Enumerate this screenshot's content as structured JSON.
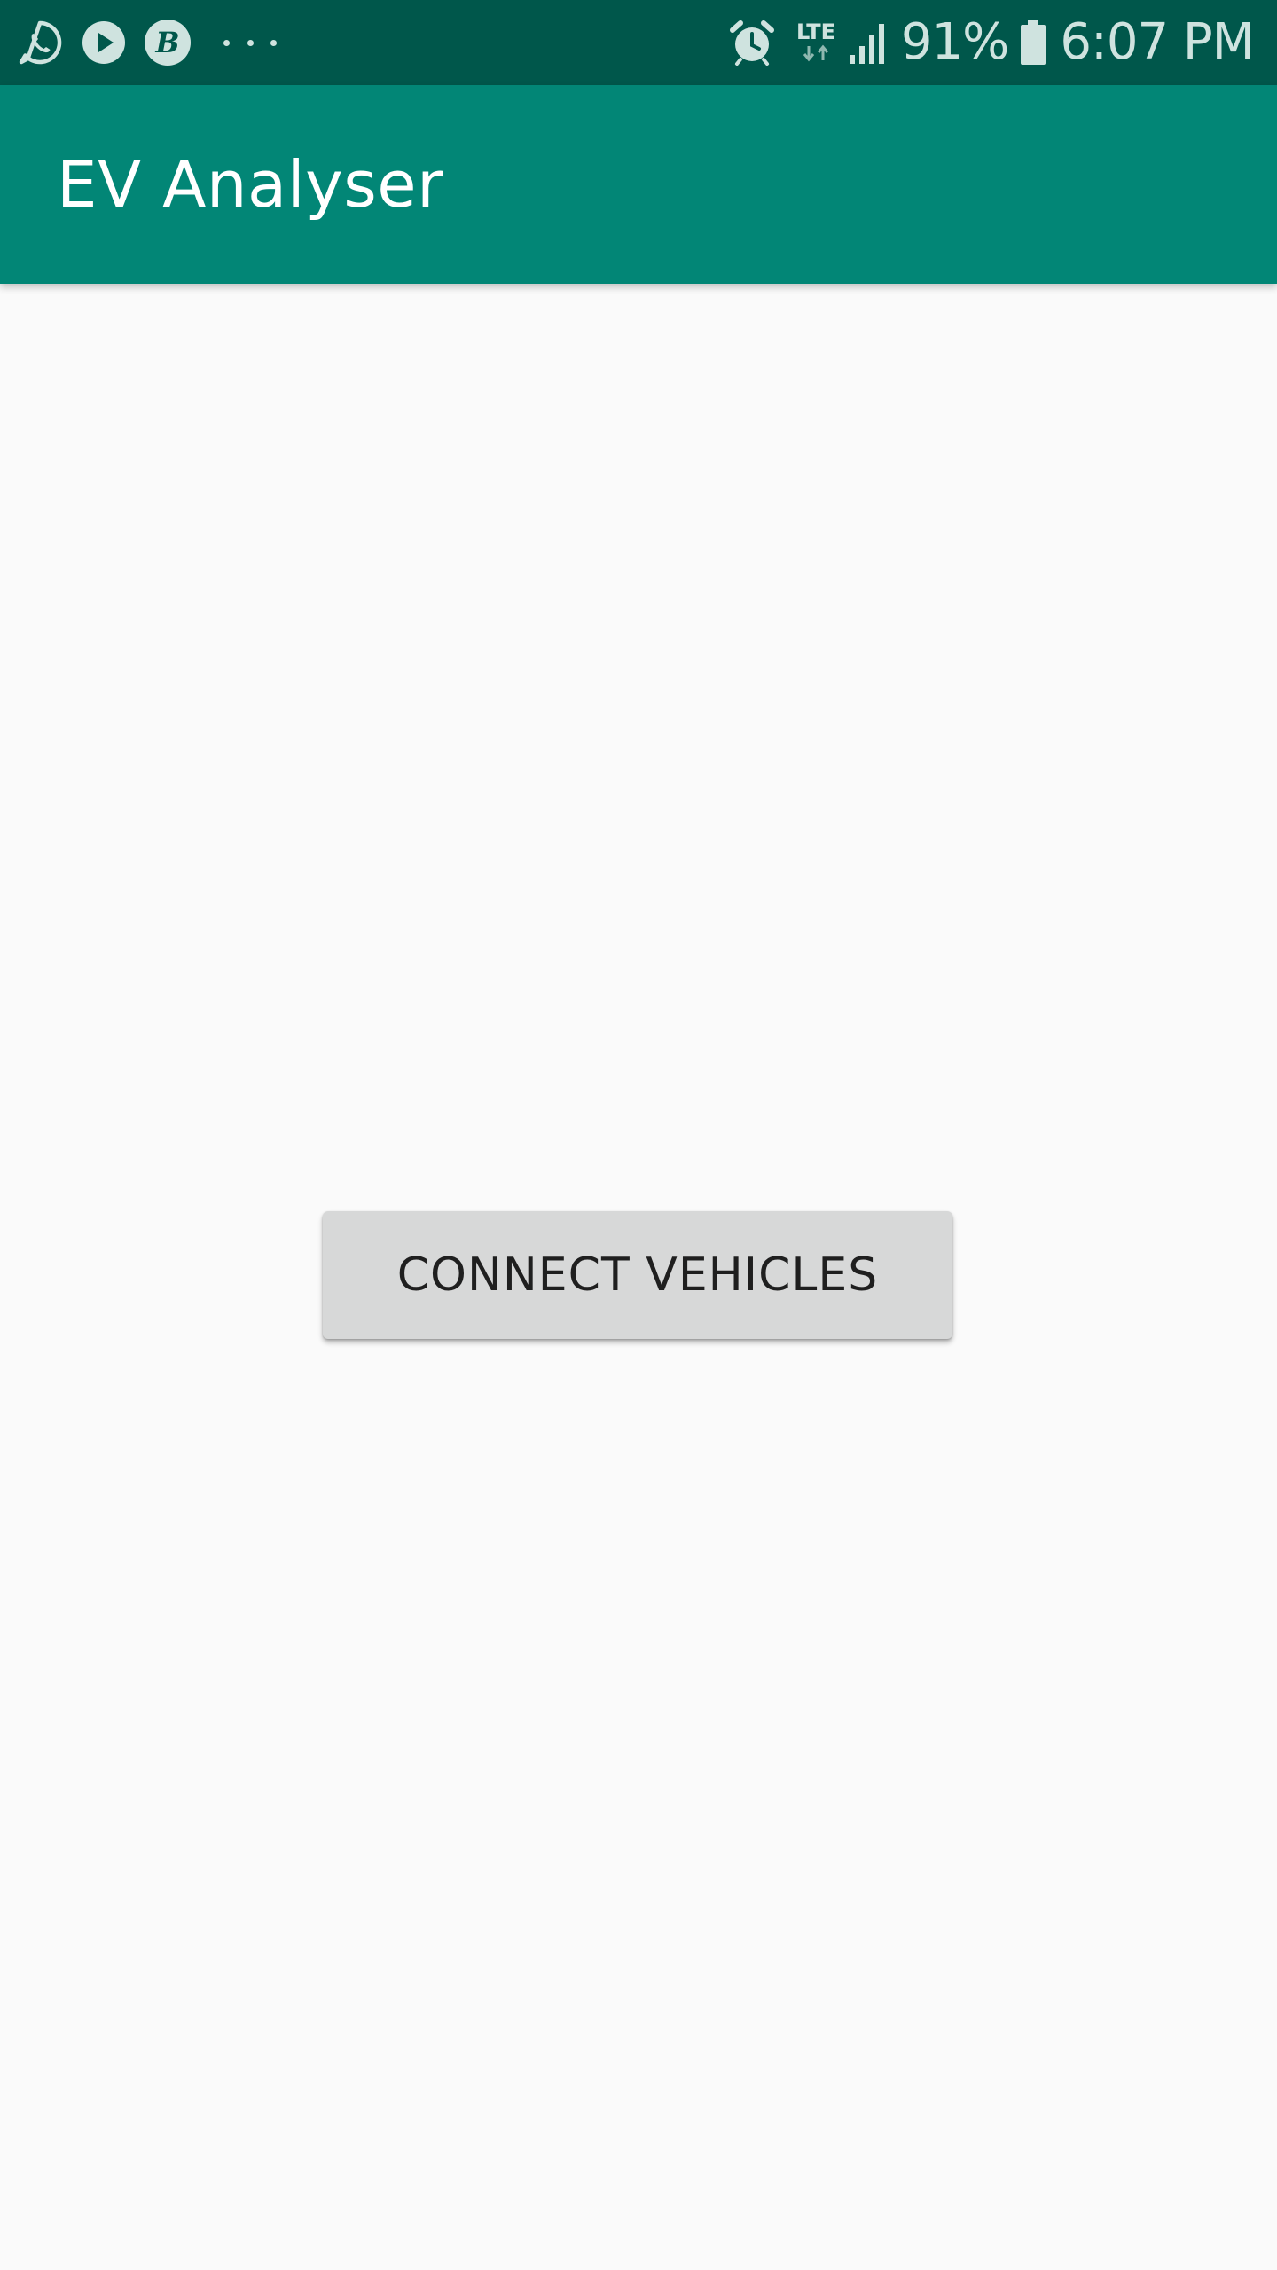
{
  "status_bar": {
    "left_icons": [
      "whatsapp-icon",
      "play-icon",
      "b-app-icon",
      "more-notifications-icon"
    ],
    "b_app_letter": "B",
    "right_icons": [
      "alarm-icon",
      "lte-icon",
      "signal-icon",
      "battery-icon"
    ],
    "network_label": "LTE",
    "battery_percent": "91%",
    "time": "6:07 PM",
    "background_color": "#00574b"
  },
  "app_bar": {
    "title": "EV Analyser",
    "background_color": "#028676"
  },
  "main": {
    "connect_button_label": "CONNECT VEHICLES",
    "background_color": "#fafafa",
    "button_color": "#d7d8d8"
  }
}
